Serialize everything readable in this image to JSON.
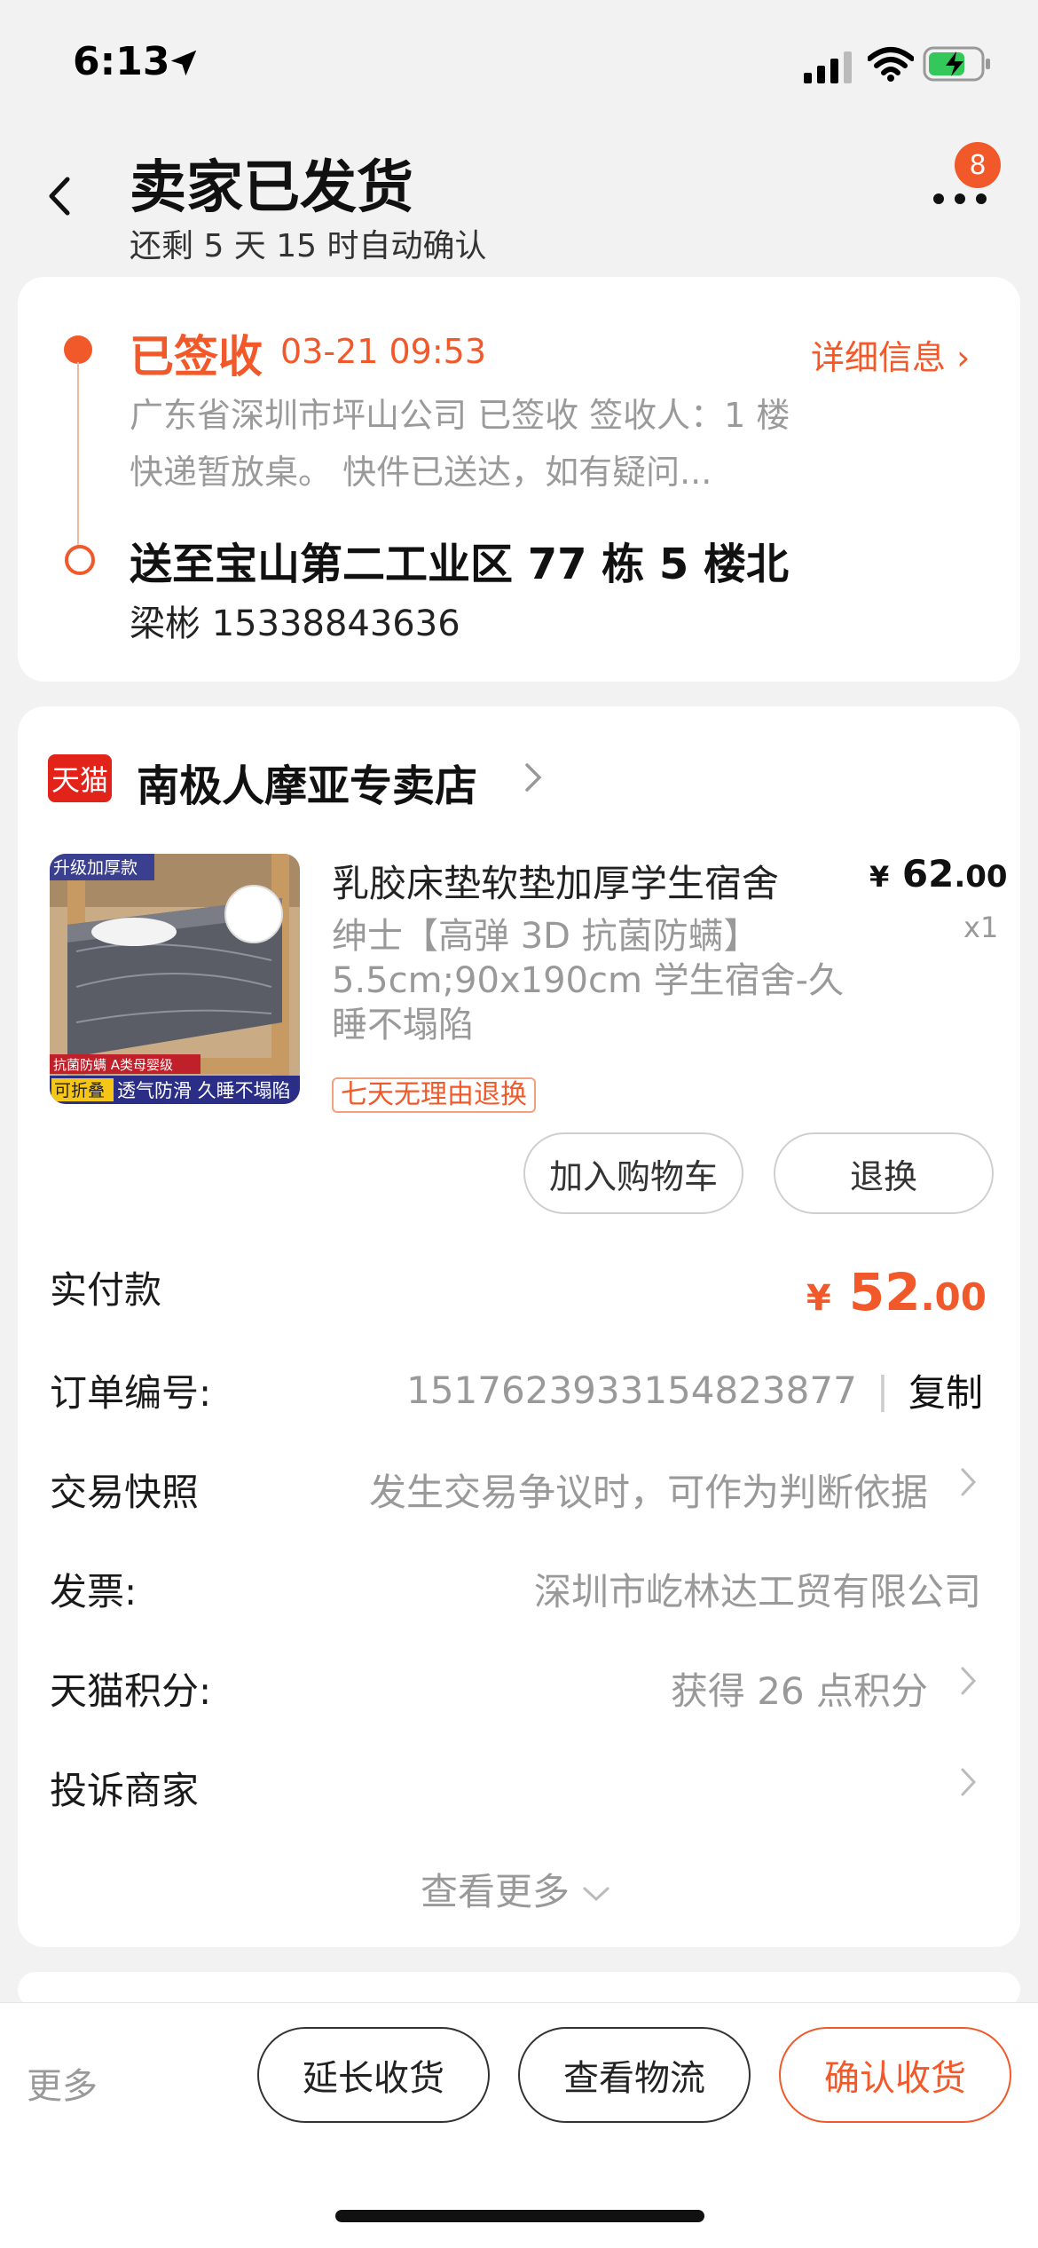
{
  "status_bar": {
    "time": "6:13"
  },
  "header": {
    "title": "卖家已发货",
    "subtitle": "还剩 5 天 15 时自动确认",
    "badge_count": "8"
  },
  "logistics": {
    "status": "已签收",
    "time": "03-21 09:53",
    "detail_link": "详细信息 ›",
    "track_text": "广东省深圳市坪山公司 已签收 签收人：1 楼快递暂放桌。 快件已送达，如有疑问...",
    "address": "送至宝山第二工业区 77 栋 5 楼北",
    "recipient": "梁彬 15338843636"
  },
  "store": {
    "logo_text": "天猫",
    "name": "南极人摩亚专卖店"
  },
  "product": {
    "title": "乳胶床垫软垫加厚学生宿舍",
    "price_symbol": "¥",
    "price_int": "62",
    "price_dec": ".00",
    "qty": "x1",
    "spec": "绅士【高弹 3D 抗菌防螨】5.5cm;90x190cm 学生宿舍-久睡不塌陷",
    "tag": "七天无理由退换",
    "img_top_label": "升级加厚款",
    "img_mid_label": "抗菌防螨 A类母婴级",
    "img_bottom_tag": "可折叠",
    "img_bottom_label": "透气防滑 久睡不塌陷",
    "buttons": {
      "cart": "加入购物车",
      "return": "退换"
    }
  },
  "order": {
    "paid_label": "实付款",
    "paid_symbol": "¥",
    "paid_int": "52",
    "paid_dec": ".00",
    "order_no_label": "订单编号:",
    "order_no": "1517623933154823877",
    "copy": "复制",
    "snapshot_label": "交易快照",
    "snapshot_value": "发生交易争议时，可作为判断依据",
    "invoice_label": "发票:",
    "invoice_value": "深圳市屹林达工贸有限公司",
    "points_label": "天猫积分:",
    "points_value": "获得 26 点积分",
    "complain_label": "投诉商家",
    "see_more": "查看更多"
  },
  "bottom": {
    "more": "更多",
    "extend": "延长收货",
    "logistics": "查看物流",
    "confirm": "确认收货"
  },
  "colors": {
    "accent": "#f1592a",
    "tmall_red": "#e2231a"
  }
}
